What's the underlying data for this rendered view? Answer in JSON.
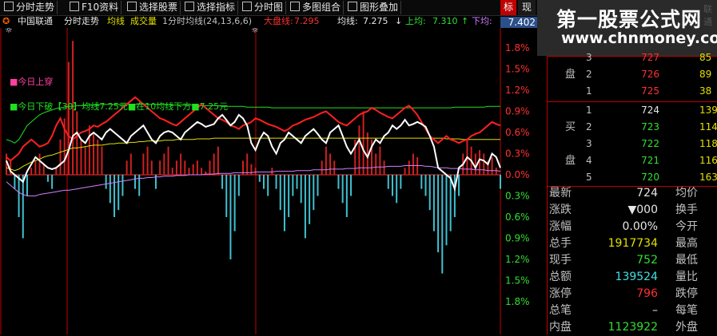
{
  "toolbar": {
    "buttons": [
      "分时走势",
      "F10资料",
      "选择股票",
      "选择指标",
      "分时图",
      "多图组合",
      "图形叠加"
    ],
    "tab_a": "标",
    "tab_b": "现"
  },
  "watermark": {
    "title": "第一股票公式网",
    "url": "www.chnmoney.com",
    "ghost": "联通"
  },
  "infobar": {
    "stock_name": "中国联通",
    "chart_name": "分时走势",
    "indicator_a": "均线",
    "indicator_b": "成交量",
    "params": "1分时均线(24,13,6,6)",
    "dapan_label": "大盘线:",
    "dapan_value": "7.295",
    "junxian_label": "均线:",
    "junxian_value": "7.275",
    "shangjun_label": "上均:",
    "shangjun_value": "7.310",
    "xiajun_label": "下均:"
  },
  "current_price": "7.402",
  "axis": {
    "labels": [
      "1.8%",
      "1.5%",
      "1.2%",
      "0.9%",
      "0.6%",
      "0.3%",
      "0.0%",
      "0.3%",
      "0.6%",
      "0.9%",
      "1.2%",
      "1.5%",
      "1.8%"
    ]
  },
  "legend": {
    "line1": "■今日上穿",
    "line2": "■今日下破【30】均线7.25元■在10均线下方■7.25元"
  },
  "colors": {
    "red": "#ff2020",
    "green": "#20e020",
    "cyan": "#40c0d0",
    "yellow": "#e0e000",
    "white": "#ffffff",
    "magenta": "#ff40a0",
    "violet": "#d080ff",
    "axis_red": "#ff3030",
    "axis_green": "#30e030"
  },
  "order_book": {
    "sell_label": "卖盘",
    "buy_label": "买盘",
    "sell": [
      {
        "level": "3",
        "price": "727",
        "volume": "85"
      },
      {
        "level": "2",
        "price": "726",
        "volume": "89"
      },
      {
        "level": "1",
        "price": "725",
        "volume": "38"
      }
    ],
    "buy": [
      {
        "level": "1",
        "price": "724",
        "volume": "139"
      },
      {
        "level": "2",
        "price": "723",
        "volume": "114"
      },
      {
        "level": "3",
        "price": "722",
        "volume": "118"
      },
      {
        "level": "4",
        "price": "721",
        "volume": "116"
      },
      {
        "level": "5",
        "price": "720",
        "volume": "163"
      }
    ]
  },
  "quotes": [
    {
      "label": "最新",
      "value": "724",
      "label2": "均价"
    },
    {
      "label": "涨跌",
      "value": "▼000",
      "label2": "换手"
    },
    {
      "label": "涨幅",
      "value": "0.00%",
      "label2": "今开"
    },
    {
      "label": "总手",
      "value": "1917734",
      "label2": "最高"
    },
    {
      "label": "现手",
      "value": "752",
      "label2": "最低"
    },
    {
      "label": "总额",
      "value": "139524",
      "label2": "量比"
    },
    {
      "label": "涨停",
      "value": "796",
      "label2": "跌停"
    },
    {
      "label": "总笔",
      "value": "–",
      "label2": "每笔"
    },
    {
      "label": "内盘",
      "value": "1123922",
      "label2": "外盘"
    }
  ],
  "chart_data": {
    "type": "line",
    "x_count": 120,
    "ylim": [
      -1.8,
      1.8
    ],
    "y_ticks": [
      1.8,
      1.5,
      1.2,
      0.9,
      0.6,
      0.3,
      0.0,
      -0.3,
      -0.6,
      -0.9,
      -1.2,
      -1.5,
      -1.8
    ],
    "series": [
      {
        "name": "price",
        "color": "white",
        "values": [
          0.2,
          0.05,
          0.0,
          -0.05,
          -0.1,
          0.05,
          0.15,
          0.25,
          0.2,
          0.15,
          0.1,
          0.08,
          0.1,
          0.15,
          0.2,
          0.35,
          0.55,
          0.6,
          0.5,
          0.45,
          0.55,
          0.6,
          0.55,
          0.5,
          0.6,
          0.65,
          0.6,
          0.55,
          0.5,
          0.45,
          0.55,
          0.6,
          0.65,
          0.7,
          0.6,
          0.5,
          0.45,
          0.55,
          0.6,
          0.62,
          0.6,
          0.55,
          0.5,
          0.6,
          0.65,
          0.7,
          0.75,
          0.72,
          0.68,
          0.7,
          0.72,
          0.8,
          0.85,
          0.78,
          0.7,
          0.75,
          0.85,
          0.8,
          0.7,
          0.45,
          0.35,
          0.5,
          0.6,
          0.55,
          0.4,
          0.3,
          0.45,
          0.5,
          0.6,
          0.55,
          0.5,
          0.45,
          0.55,
          0.6,
          0.65,
          0.58,
          0.5,
          0.45,
          0.6,
          0.65,
          0.7,
          0.55,
          0.4,
          0.3,
          0.4,
          0.5,
          0.35,
          0.25,
          0.4,
          0.5,
          0.45,
          0.55,
          0.6,
          0.7,
          0.65,
          0.7,
          0.78,
          0.7,
          0.72,
          0.75,
          0.72,
          0.68,
          0.55,
          0.4,
          0.1,
          0.05,
          0.0,
          -0.05,
          -0.2,
          0.1,
          0.15,
          0.25,
          0.2,
          0.1,
          0.22,
          0.2,
          0.15,
          0.3,
          0.25,
          0.1
        ]
      },
      {
        "name": "red_line",
        "color": "red",
        "values": [
          0.25,
          0.2,
          0.25,
          0.3,
          0.4,
          0.45,
          0.5,
          0.45,
          0.4,
          0.42,
          0.45,
          0.55,
          0.7,
          0.8,
          0.65,
          0.55,
          0.5,
          0.55,
          0.6,
          0.62,
          0.65,
          0.7,
          0.68,
          0.72,
          0.75,
          0.8,
          0.85,
          0.9,
          0.95,
          1.0,
          1.05,
          1.1,
          1.05,
          1.0,
          0.95,
          0.9,
          0.85,
          0.8,
          0.78,
          0.75,
          0.72,
          0.7,
          0.75,
          0.8,
          0.85,
          0.9,
          0.95,
          1.0,
          0.95,
          0.9,
          0.85,
          0.8,
          0.78,
          0.75,
          0.7,
          0.68,
          0.65,
          0.7,
          0.72,
          0.75,
          0.8,
          0.78,
          0.75,
          0.72,
          0.7,
          0.68,
          0.65,
          0.62,
          0.65,
          0.7,
          0.72,
          0.75,
          0.78,
          0.8,
          0.82,
          0.85,
          0.88,
          0.9,
          0.85,
          0.8,
          0.75,
          0.72,
          0.7,
          0.75,
          0.8,
          0.85,
          0.88,
          0.9,
          0.95,
          0.92,
          0.88,
          0.85,
          0.82,
          0.8,
          0.85,
          0.9,
          0.95,
          0.98,
          0.92,
          0.85,
          0.75,
          0.65,
          0.55,
          0.5,
          0.45,
          0.5,
          0.55,
          0.5,
          0.48,
          0.45,
          0.48,
          0.5,
          0.55,
          0.58,
          0.6,
          0.65,
          0.7,
          0.75,
          0.72,
          0.7
        ]
      },
      {
        "name": "green_line",
        "color": "green",
        "values": [
          0.5,
          0.48,
          0.45,
          0.5,
          0.6,
          0.7,
          0.75,
          0.8,
          0.85,
          0.88,
          0.9,
          0.92,
          0.94,
          0.95,
          0.96,
          0.97,
          0.97,
          0.98,
          0.98,
          0.98,
          0.99,
          0.99,
          0.99,
          1.0,
          1.0,
          1.0,
          1.0,
          1.0,
          1.0,
          1.0,
          1.0,
          1.0,
          1.0,
          1.0,
          1.0,
          1.0,
          1.0,
          1.0,
          1.0,
          1.0,
          0.99,
          0.99,
          0.99,
          0.99,
          0.99,
          0.99,
          0.98,
          0.98,
          0.98,
          0.98,
          0.98,
          0.98,
          0.97,
          0.97,
          0.97,
          0.97,
          0.97,
          0.97,
          0.96,
          0.96,
          0.96,
          0.96,
          0.96,
          0.96,
          0.95,
          0.95,
          0.95,
          0.95,
          0.95,
          0.95,
          0.95,
          0.95,
          0.95,
          0.95,
          0.95,
          0.95,
          0.95,
          0.95,
          0.95,
          0.95,
          0.95,
          0.95,
          0.95,
          0.95,
          0.95,
          0.95,
          0.95,
          0.95,
          0.95,
          0.95,
          0.95,
          0.95,
          0.95,
          0.95,
          0.95,
          0.95,
          0.95,
          0.95,
          0.95,
          0.95,
          0.95,
          0.95,
          0.95,
          0.95,
          0.95,
          0.95,
          0.95,
          0.95,
          0.96,
          0.96,
          0.96,
          0.96,
          0.96,
          0.96,
          0.96,
          0.96,
          0.97,
          0.97,
          0.97,
          0.97
        ]
      },
      {
        "name": "yellow_line",
        "color": "yellow",
        "values": [
          0.1,
          0.08,
          0.06,
          0.08,
          0.12,
          0.15,
          0.18,
          0.2,
          0.22,
          0.25,
          0.27,
          0.28,
          0.3,
          0.32,
          0.34,
          0.36,
          0.38,
          0.38,
          0.39,
          0.4,
          0.41,
          0.42,
          0.42,
          0.42,
          0.43,
          0.44,
          0.44,
          0.45,
          0.45,
          0.45,
          0.46,
          0.46,
          0.47,
          0.47,
          0.48,
          0.48,
          0.48,
          0.48,
          0.49,
          0.49,
          0.49,
          0.5,
          0.5,
          0.5,
          0.5,
          0.5,
          0.51,
          0.51,
          0.51,
          0.51,
          0.52,
          0.52,
          0.52,
          0.52,
          0.52,
          0.52,
          0.52,
          0.52,
          0.52,
          0.52,
          0.52,
          0.52,
          0.52,
          0.52,
          0.52,
          0.52,
          0.52,
          0.52,
          0.52,
          0.52,
          0.52,
          0.52,
          0.52,
          0.52,
          0.52,
          0.52,
          0.52,
          0.52,
          0.52,
          0.52,
          0.52,
          0.52,
          0.52,
          0.52,
          0.52,
          0.52,
          0.52,
          0.52,
          0.52,
          0.52,
          0.52,
          0.52,
          0.52,
          0.52,
          0.52,
          0.52,
          0.52,
          0.52,
          0.52,
          0.52,
          0.52,
          0.52,
          0.52,
          0.52,
          0.52,
          0.52,
          0.51,
          0.51,
          0.51,
          0.51,
          0.5,
          0.5,
          0.5,
          0.5,
          0.5,
          0.5,
          0.5,
          0.5,
          0.5,
          0.5
        ]
      },
      {
        "name": "violet_line",
        "color": "violet",
        "values": [
          -0.1,
          -0.15,
          -0.2,
          -0.25,
          -0.28,
          -0.3,
          -0.3,
          -0.3,
          -0.28,
          -0.27,
          -0.26,
          -0.25,
          -0.24,
          -0.23,
          -0.22,
          -0.22,
          -0.21,
          -0.2,
          -0.19,
          -0.18,
          -0.17,
          -0.16,
          -0.15,
          -0.14,
          -0.13,
          -0.12,
          -0.11,
          -0.1,
          -0.09,
          -0.08,
          -0.07,
          -0.06,
          -0.05,
          -0.05,
          -0.04,
          -0.04,
          -0.03,
          -0.03,
          -0.02,
          -0.02,
          -0.02,
          -0.01,
          -0.01,
          -0.01,
          0.0,
          0.0,
          0.0,
          0.0,
          0.01,
          0.01,
          0.01,
          0.02,
          0.02,
          0.02,
          0.02,
          0.03,
          0.03,
          0.03,
          0.03,
          0.03,
          0.04,
          0.04,
          0.04,
          0.04,
          0.04,
          0.05,
          0.05,
          0.05,
          0.05,
          0.05,
          0.06,
          0.06,
          0.06,
          0.06,
          0.07,
          0.07,
          0.07,
          0.07,
          0.08,
          0.08,
          0.08,
          0.08,
          0.09,
          0.09,
          0.09,
          0.1,
          0.1,
          0.1,
          0.1,
          0.11,
          0.11,
          0.11,
          0.12,
          0.12,
          0.12,
          0.12,
          0.13,
          0.13,
          0.13,
          0.13,
          0.13,
          0.12,
          0.12,
          0.11,
          0.1,
          0.1,
          0.1,
          0.09,
          0.09,
          0.09,
          0.08,
          0.08,
          0.08,
          0.07,
          0.07,
          0.07,
          0.06,
          0.06,
          0.06,
          0.05
        ]
      },
      {
        "name": "bars",
        "color": "red/cyan",
        "values": [
          0.3,
          0.2,
          -0.2,
          -0.6,
          -0.9,
          -0.3,
          0.1,
          0.2,
          0.3,
          0.15,
          -0.1,
          -0.2,
          0.1,
          0.5,
          0.8,
          1.6,
          1.9,
          0.9,
          0.5,
          0.4,
          0.7,
          0.6,
          0.5,
          0.4,
          -0.2,
          -0.4,
          -0.6,
          -0.5,
          -0.3,
          0.2,
          0.3,
          -0.2,
          -0.3,
          0.3,
          0.4,
          0.2,
          -0.2,
          0.2,
          0.3,
          0.4,
          0.1,
          0.2,
          0.3,
          0.2,
          0.1,
          0.15,
          0.2,
          0.1,
          0.05,
          0.2,
          0.3,
          0.4,
          -0.2,
          -0.6,
          -1.2,
          -0.8,
          -0.3,
          0.2,
          0.3,
          0.15,
          0.1,
          -0.1,
          -0.2,
          -0.3,
          0.1,
          -0.2,
          -0.5,
          -0.8,
          -0.6,
          -0.3,
          -0.2,
          -0.4,
          -0.9,
          -0.7,
          -0.5,
          -0.3,
          0.2,
          0.4,
          0.3,
          0.2,
          -0.2,
          -0.4,
          -0.6,
          -0.3,
          0.5,
          0.7,
          0.9,
          0.6,
          0.5,
          0.3,
          0.4,
          0.2,
          -0.2,
          -0.3,
          -0.4,
          -0.2,
          0.1,
          0.2,
          0.3,
          0.25,
          -0.2,
          -0.3,
          -0.5,
          -0.8,
          -1.1,
          -1.4,
          -1.0,
          -0.8,
          -0.6,
          -0.3,
          0.3,
          0.5,
          0.4,
          0.3,
          0.35,
          0.3,
          0.2,
          0.25,
          0.1,
          -0.2
        ]
      }
    ]
  }
}
